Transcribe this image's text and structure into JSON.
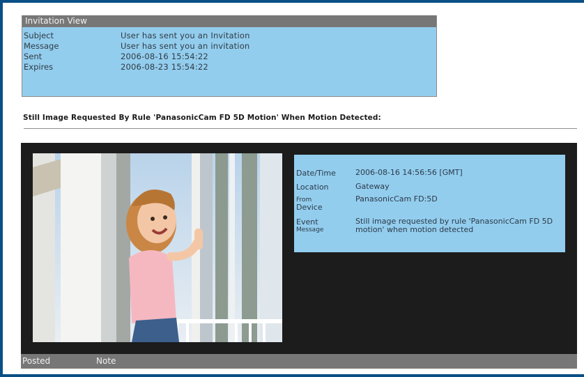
{
  "invitation": {
    "title": "Invitation View",
    "rows": [
      {
        "label": "Subject",
        "value": "User has sent you an Invitation"
      },
      {
        "label": "Message",
        "value": "User has sent you an invitation"
      },
      {
        "label": "Sent",
        "value": "2006-08-16 15:54:22"
      },
      {
        "label": "Expires",
        "value": "2006-08-23 15:54:22"
      }
    ]
  },
  "heading": "Still Image Requested By Rule 'PanasonicCam FD 5D Motion' When Motion Detected:",
  "event": {
    "datetime_label": "Date/Time",
    "datetime_value": "2006-08-16 14:56:56 [GMT]",
    "location_label": "Location",
    "location_value": "Gateway",
    "from_label": "From",
    "device_label": "Device",
    "from_value": "PanasonicCam FD:5D",
    "event_label": "Event",
    "message_label": "Message",
    "event_value": "Still image requested by rule 'PanasonicCam FD 5D motion' when motion detected"
  },
  "footer": {
    "posted": "Posted",
    "note": "Note"
  }
}
